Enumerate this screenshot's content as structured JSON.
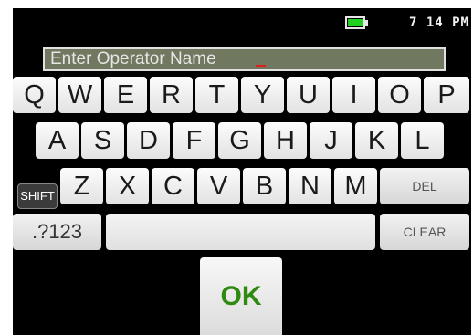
{
  "status_bar": {
    "clock": "7 14 PM",
    "battery_icon": "battery-full-icon",
    "battery_level": 1.0,
    "battery_color": "#21d121"
  },
  "input": {
    "placeholder": "Enter Operator Name",
    "value": ""
  },
  "keyboard": {
    "row1": [
      "Q",
      "W",
      "E",
      "R",
      "T",
      "Y",
      "U",
      "I",
      "O",
      "P"
    ],
    "row2": [
      "A",
      "S",
      "D",
      "F",
      "G",
      "H",
      "J",
      "K",
      "L"
    ],
    "row3": [
      "Z",
      "X",
      "C",
      "V",
      "B",
      "N",
      "M"
    ],
    "shift_label": "SHIFT",
    "del_label": "DEL",
    "symbols_label": ".?123",
    "space_label": "",
    "clear_label": "CLEAR"
  },
  "ok_label": "OK",
  "colors": {
    "background": "#000000",
    "key_face": "#f0f0f0",
    "ok_text": "#2f8a12",
    "caret": "#e0201a"
  }
}
